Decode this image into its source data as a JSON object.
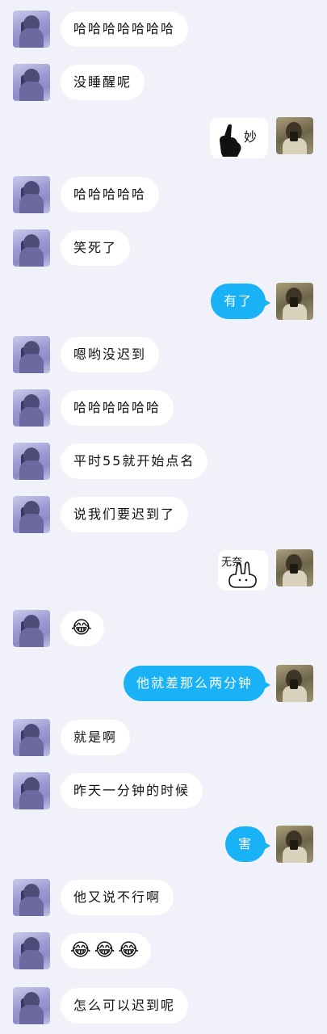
{
  "messages": [
    {
      "side": "left",
      "text": "哈哈哈哈哈哈哈"
    },
    {
      "side": "left",
      "text": "没睡醒呢"
    },
    {
      "side": "right",
      "sticker": "finger-sticker",
      "sticker_text": "妙"
    },
    {
      "side": "left",
      "text": "哈哈哈哈哈"
    },
    {
      "side": "left",
      "text": "笑死了"
    },
    {
      "side": "right",
      "text": "有了"
    },
    {
      "side": "left",
      "text": "嗯哟没迟到"
    },
    {
      "side": "left",
      "text": "哈哈哈哈哈哈"
    },
    {
      "side": "left",
      "text": "平时55就开始点名"
    },
    {
      "side": "left",
      "text": "说我们要迟到了"
    },
    {
      "side": "right",
      "sticker": "bunny-sticker",
      "sticker_text": "无奈"
    },
    {
      "side": "left",
      "text": "😂"
    },
    {
      "side": "right",
      "text": "他就差那么两分钟"
    },
    {
      "side": "left",
      "text": "就是啊"
    },
    {
      "side": "left",
      "text": "昨天一分钟的时候"
    },
    {
      "side": "right",
      "text": "害"
    },
    {
      "side": "left",
      "text": "他又说不行啊"
    },
    {
      "side": "left",
      "text": "😂😂😂"
    },
    {
      "side": "left",
      "text": "怎么可以迟到呢"
    }
  ]
}
